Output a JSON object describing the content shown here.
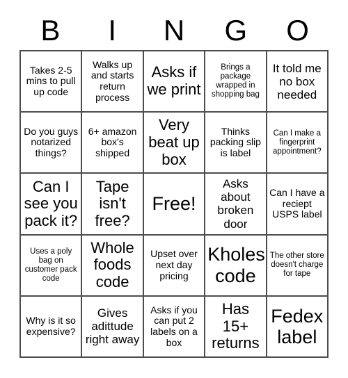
{
  "card": {
    "header_letters": [
      "B",
      "I",
      "N",
      "G",
      "O"
    ],
    "rows": [
      [
        {
          "text": "Takes 2-5 mins to pull up code",
          "size": "sm"
        },
        {
          "text": "Walks up and starts return process",
          "size": "sm"
        },
        {
          "text": "Asks if we print",
          "size": "lg"
        },
        {
          "text": "Brings a package wrapped in shopping bag",
          "size": "xs"
        },
        {
          "text": "It told me no box needed",
          "size": "md"
        }
      ],
      [
        {
          "text": "Do you guys notarized things?",
          "size": "sm"
        },
        {
          "text": "6+ amazon box's shipped",
          "size": "sm"
        },
        {
          "text": "Very beat up box",
          "size": "lg"
        },
        {
          "text": "Thinks packing slip is label",
          "size": "sm"
        },
        {
          "text": "Can I make a fingerprint appointment?",
          "size": "xs"
        }
      ],
      [
        {
          "text": "Can I see you pack it?",
          "size": "lg"
        },
        {
          "text": "Tape isn't free?",
          "size": "lg"
        },
        {
          "text": "Free!",
          "size": "xl"
        },
        {
          "text": "Asks about broken door",
          "size": "md"
        },
        {
          "text": "Can I have a reciept USPS label",
          "size": "sm"
        }
      ],
      [
        {
          "text": "Uses a poly bag on customer pack code",
          "size": "xs"
        },
        {
          "text": "Whole foods code",
          "size": "lg"
        },
        {
          "text": "Upset over next day pricing",
          "size": "sm"
        },
        {
          "text": "Kholes code",
          "size": "xl"
        },
        {
          "text": "The other store doesn't charge for tape",
          "size": "xs"
        }
      ],
      [
        {
          "text": "Why is it so expensive?",
          "size": "sm"
        },
        {
          "text": "Gives adittude right away",
          "size": "md"
        },
        {
          "text": "Asks if you can put 2 labels on a box",
          "size": "sm"
        },
        {
          "text": "Has 15+ returns",
          "size": "lg"
        },
        {
          "text": "Fedex label",
          "size": "xl"
        }
      ]
    ],
    "colors": {
      "border": "#4d4d4d",
      "text": "#000000",
      "background": "#ffffff"
    }
  }
}
